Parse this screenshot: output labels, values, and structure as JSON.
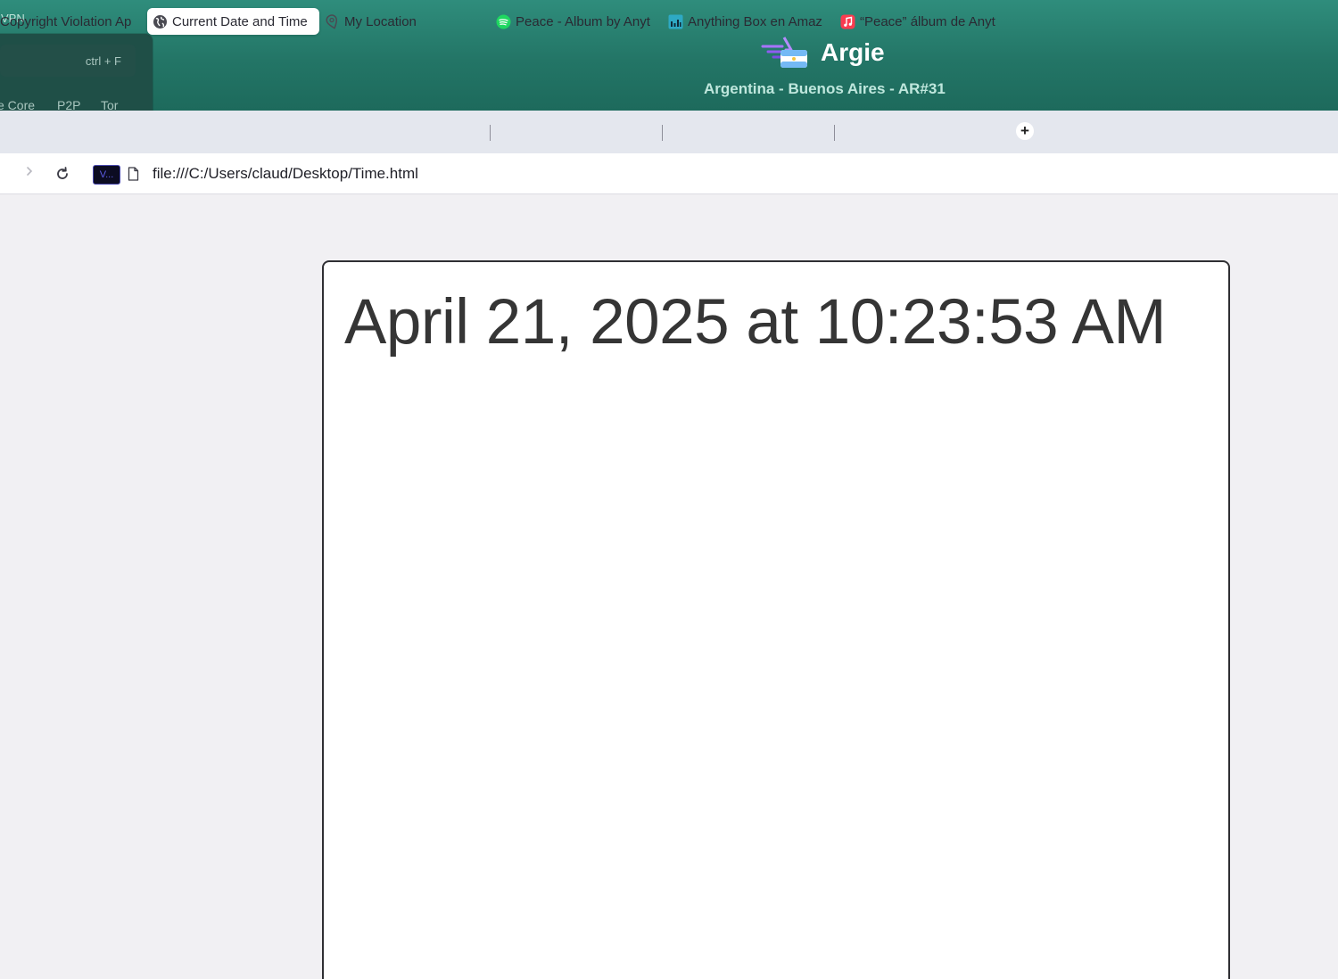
{
  "vpn": {
    "label": "VPN",
    "search_shortcut": "ctrl + F",
    "filters": [
      "e Core",
      "P2P",
      "Tor"
    ],
    "server_name": "Argie",
    "server_location": "Argentina - Buenos Aires - AR#31"
  },
  "tabs": [
    {
      "label": "Copyright Violation Ap",
      "icon": "none",
      "active": false
    },
    {
      "label": "Current Date and Time",
      "icon": "globe-icon",
      "active": true
    },
    {
      "label": "My Location",
      "icon": "location-pin-icon",
      "active": false
    },
    {
      "label": "Peace - Album by Anyt",
      "icon": "spotify-icon",
      "active": false
    },
    {
      "label": "Anything Box en Amaz",
      "icon": "amazon-music-icon",
      "active": false
    },
    {
      "label": "“Peace” álbum de Anyt",
      "icon": "apple-music-icon",
      "active": false
    }
  ],
  "new_tab_label": "+",
  "address_bar": {
    "extension_label": "V...",
    "url": "file:///C:/Users/claud/Desktop/Time.html"
  },
  "page": {
    "datetime": "April 21, 2025 at 10:23:53 AM"
  },
  "colors": {
    "vpn_bar": "#237566",
    "tab_strip": "#e4e7ee",
    "page_bg": "#f1f0f3",
    "spotify": "#1ed760",
    "apple_music": "#fa3c50",
    "amazon_music": "#2ea9c4"
  }
}
